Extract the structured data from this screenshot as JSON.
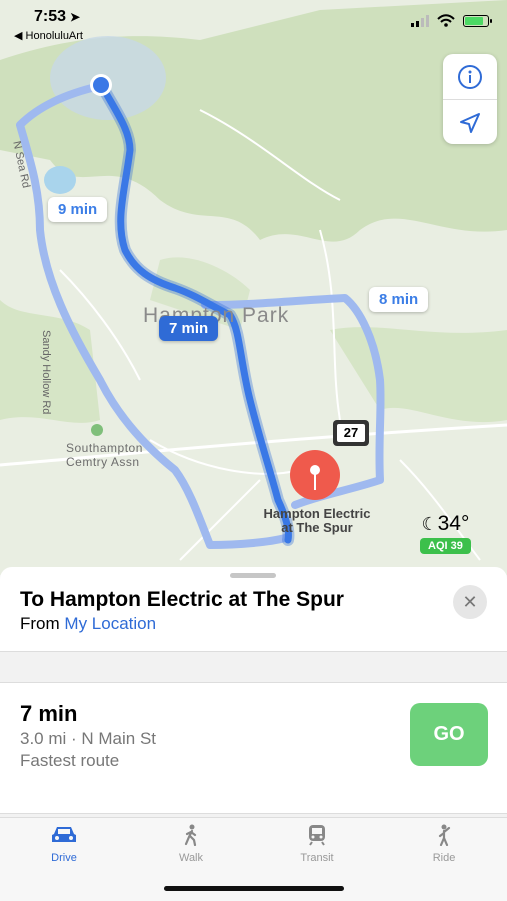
{
  "status_bar": {
    "time": "7:53",
    "back_app": "◀ HonoluluArt"
  },
  "map": {
    "route_bubbles": {
      "alt_left": "9 min",
      "selected": "7 min",
      "alt_right": "8 min"
    },
    "place_labels": {
      "area": "Hampton Park",
      "cemetery_line1": "Southampton",
      "cemetery_line2": "Cemtry Assn",
      "road_n_sea": "N Sea Rd",
      "road_sandy_hollow": "Sandy Hollow Rd",
      "route_shield": "27"
    },
    "destination": {
      "line1": "Hampton Electric",
      "line2": "at The Spur"
    },
    "weather": {
      "temp": "34°",
      "aqi": "AQI 39"
    },
    "icons": [
      "info-icon",
      "location-arrow-icon",
      "moon-icon",
      "pin-icon"
    ]
  },
  "sheet": {
    "title": "To Hampton Electric at The Spur",
    "from_label": "From",
    "from_link": "My Location",
    "close_symbol": "✕",
    "route": {
      "time": "7 min",
      "detail": "3.0 mi · N Main St",
      "note": "Fastest route",
      "go_label": "GO"
    }
  },
  "tabbar": {
    "tabs": [
      {
        "label": "Drive",
        "icon": "car-icon",
        "active": true
      },
      {
        "label": "Walk",
        "icon": "walk-icon",
        "active": false
      },
      {
        "label": "Transit",
        "icon": "train-icon",
        "active": false
      },
      {
        "label": "Ride",
        "icon": "ride-icon",
        "active": false
      }
    ]
  },
  "colors": {
    "accent": "#2f6bd6",
    "route_alt": "#9fb9ef",
    "go": "#6dd17b",
    "pin": "#ef5a4c",
    "aqi": "#3cc04b"
  }
}
